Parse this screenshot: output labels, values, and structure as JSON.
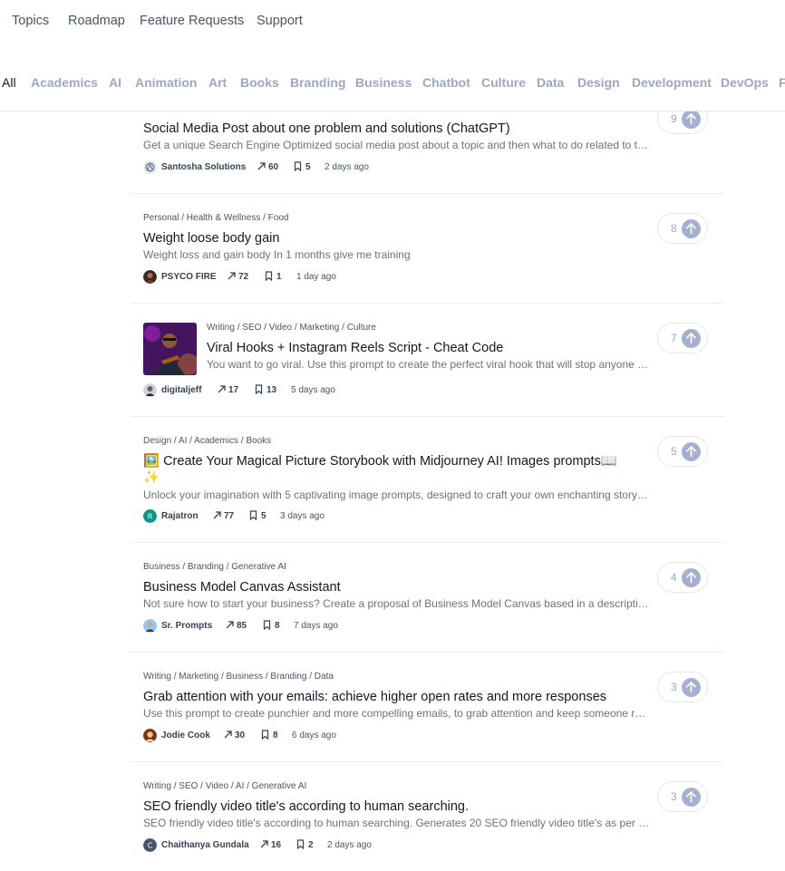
{
  "topnav": [
    "Topics",
    "Roadmap",
    "Feature Requests",
    "Support"
  ],
  "categories": [
    "All",
    "Academics",
    "AI",
    "Animation",
    "Art",
    "Books",
    "Branding",
    "Business",
    "Chatbot",
    "Culture",
    "Data",
    "Design",
    "Development",
    "DevOps",
    "F"
  ],
  "colors": {
    "accent": "#a5b0d1",
    "muted": "#9ca8c2"
  },
  "cards": [
    {
      "categories": "",
      "title": "Social Media Post about one problem and solutions (ChatGPT)",
      "description": "Get a unique Search Engine Optimized social media post about a topic and then what to do related to th…",
      "author": "Santosha Solutions",
      "views": "60",
      "saves": "5",
      "ago": "2 days ago",
      "votes": "9"
    },
    {
      "categories": "Personal / Health & Wellness / Food",
      "title": "Weight loose body gain",
      "description": "Weight loss and gain body In 1 months give me training",
      "author": "PSYCO FIRE",
      "views": "72",
      "saves": "1",
      "ago": "1 day ago",
      "votes": "8"
    },
    {
      "categories": "Writing / SEO / Video / Marketing / Culture",
      "title": "Viral Hooks + Instagram Reels Script - Cheat Code",
      "description": "You want to go viral. Use this prompt to create the perfect viral hook that will stop anyone f…",
      "author": "digitaljeff",
      "views": "17",
      "saves": "13",
      "ago": "5 days ago",
      "votes": "7"
    },
    {
      "categories": "Design / AI / Academics / Books",
      "title": "🖼️ Create Your Magical Picture Storybook with Midjourney AI! Images prompts📖",
      "title2": "✨",
      "description": "Unlock your imagination with 5 captivating image prompts, designed to craft your own enchanting story…",
      "author": "Rajatron",
      "views": "77",
      "saves": "5",
      "ago": "3 days ago",
      "votes": "5"
    },
    {
      "categories": "Business / Branding / Generative AI",
      "title": "Business Model Canvas Assistant",
      "description": "Not sure how to start your business? Create a proposal of Business Model Canvas based in a descriptio…",
      "author": "Sr. Prompts",
      "views": "85",
      "saves": "8",
      "ago": "7 days ago",
      "votes": "4"
    },
    {
      "categories": "Writing / Marketing / Business / Branding / Data",
      "title": "Grab attention with your emails: achieve higher open rates and more responses",
      "description": "Use this prompt to create punchier and more compelling emails, to grab attention and keep someone re…",
      "author": "Jodie Cook",
      "views": "30",
      "saves": "8",
      "ago": "6 days ago",
      "votes": "3"
    },
    {
      "categories": "Writing / SEO / Video / AI / Generative AI",
      "title": "SEO friendly video title's according to human searching.",
      "description": "SEO friendly video title's according to human searching. Generates 20 SEO friendly video title's as per na…",
      "author": "Chaithanya Gundala",
      "views": "16",
      "saves": "2",
      "ago": "2 days ago",
      "votes": "3"
    }
  ]
}
